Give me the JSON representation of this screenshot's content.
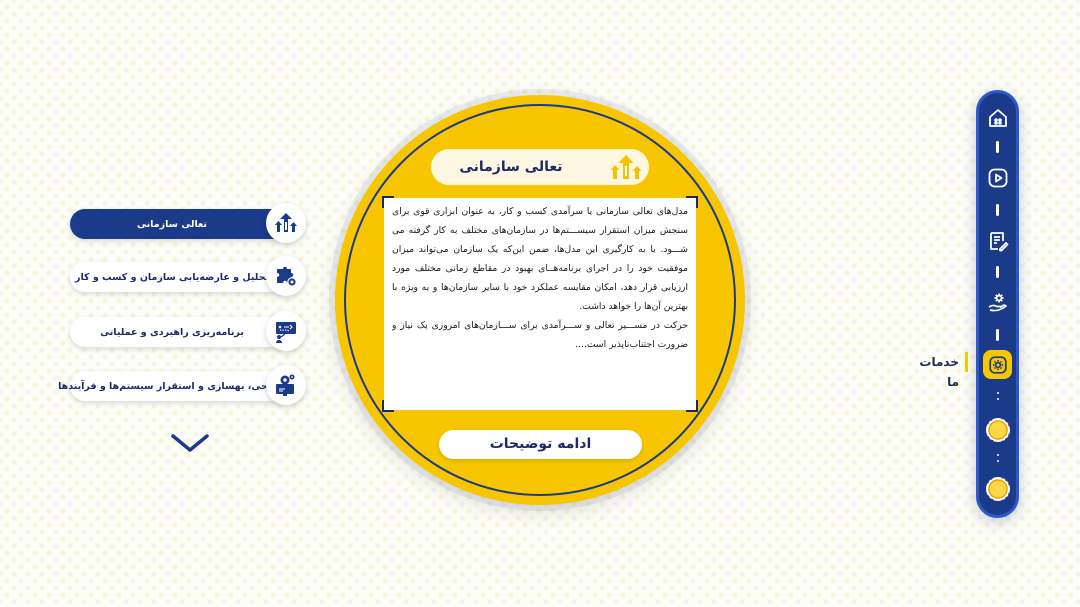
{
  "nav": {
    "active_label": "خدمات ما",
    "items": [
      {
        "icon": "home-icon"
      },
      {
        "icon": "play-icon"
      },
      {
        "icon": "document-icon"
      },
      {
        "icon": "hand-gear-icon"
      },
      {
        "icon": "services-icon"
      },
      {
        "icon": "circle-icon"
      },
      {
        "icon": "circle-icon"
      }
    ]
  },
  "menu": {
    "items": [
      {
        "label": "تعالی سازمانی",
        "icon": "growth-arrows-icon",
        "active": true
      },
      {
        "label": "تحلیل و عارضه‌یابی سازمان و کسب و کار",
        "icon": "puzzle-icon",
        "active": false
      },
      {
        "label": "برنامه‌ریزی راهبردی و عملیاتی",
        "icon": "strategy-board-icon",
        "active": false
      },
      {
        "label": "طراحی، بهسازی و استقرار سیستم‌ها و فرآیندها",
        "icon": "process-gear-icon",
        "active": false
      }
    ]
  },
  "card": {
    "title": "تعالی سازمانی",
    "paragraphs": [
      "مدل‌های تعالی سازمانی یا سرآمدی کسب و کار، به عنوان ابزاری قوی برای سنجش میزان استقرار سیســـتم‌ها در سازمان‌های مختلف به کار گرفته می شـــود. با به کارگیری این مدل‌ها، ضمن این‌که یک سازمان می‌تواند میزان موفقیت خود را در اجرای برنامه‌هــای بهبود در مقاطع زمانی مختلف مورد ارزیابی قرار دهد، امکان مقایسه عملکرد خود با سایر سازمان‌ها و به ویژه با بهترین آن‌ها را خواهد داشت.",
      "حرکت در مســـیر تعالی و ســـرآمدی برای ســـازمان‌های امروزی یک نیاز و ضرورت اجتناب‌ناپذیر است...."
    ],
    "more_label": "ادامه توضیحات"
  },
  "colors": {
    "navy": "#1c3a8a",
    "yellow": "#f7c600",
    "text_dark": "#1c2a6a"
  }
}
